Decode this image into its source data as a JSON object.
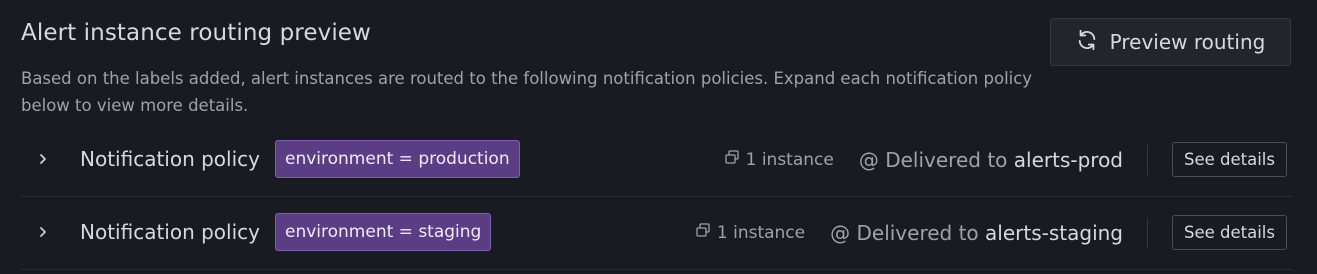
{
  "header": {
    "title": "Alert instance routing preview",
    "description": "Based on the labels added, alert instances are routed to the following notification policies. Expand each notification policy below to view more details.",
    "preview_button_label": "Preview routing"
  },
  "policies": [
    {
      "label": "Notification policy",
      "matcher": "environment = production",
      "instances": "1 instance",
      "delivered_prefix": "@ Delivered to",
      "contact_point": "alerts-prod",
      "details_label": "See details"
    },
    {
      "label": "Notification policy",
      "matcher": "environment = staging",
      "instances": "1 instance",
      "delivered_prefix": "@ Delivered to",
      "contact_point": "alerts-staging",
      "details_label": "See details"
    }
  ],
  "colors": {
    "background": "#181b1f",
    "matcher_bg": "#5a3d84",
    "matcher_border": "#7d5fb2"
  }
}
